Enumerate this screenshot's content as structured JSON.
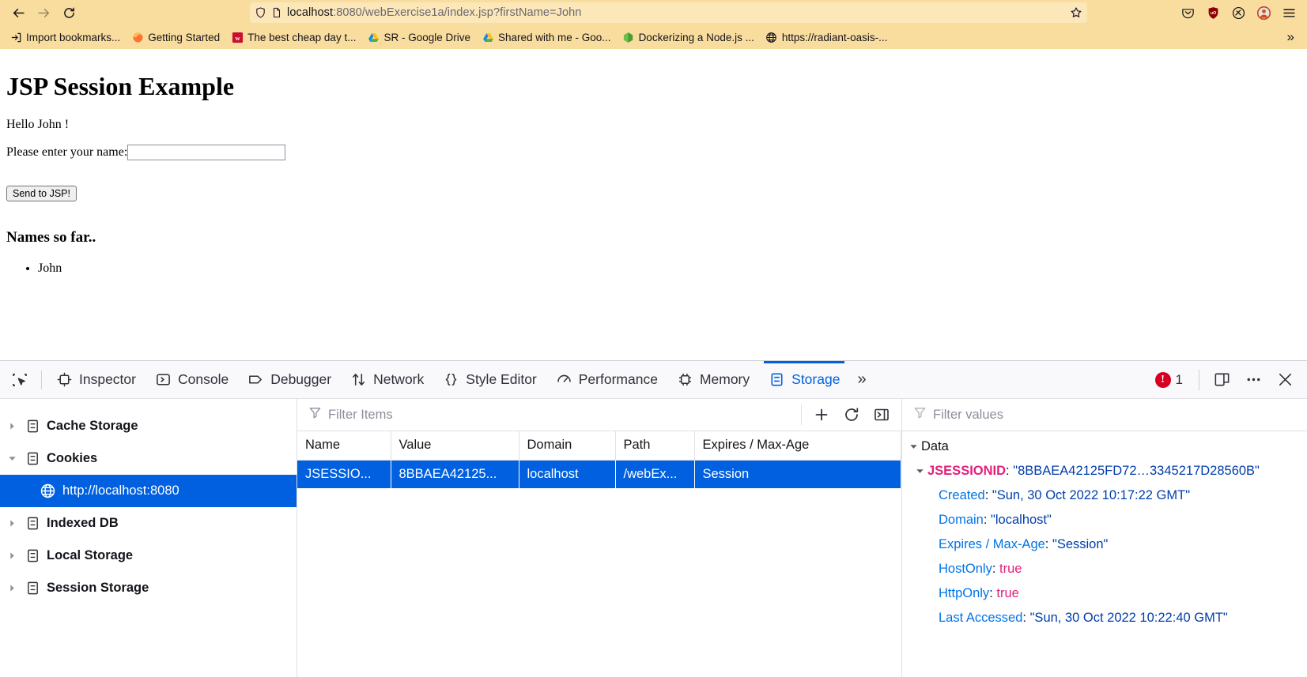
{
  "browser": {
    "nav": {
      "back": "back-arrow",
      "forward": "forward-arrow",
      "reload": "reload"
    },
    "urlbar": {
      "shield_icon": "shield-icon",
      "page_icon": "page-icon",
      "host": "localhost",
      "rest": ":8080/webExercise1a/index.jsp?firstName=John",
      "bookmark_icon": "star-icon"
    },
    "toolbar_icons": [
      {
        "name": "pocket-icon"
      },
      {
        "name": "ublock-origin-icon"
      },
      {
        "name": "extension-icon"
      },
      {
        "name": "account-avatar-icon"
      },
      {
        "name": "app-menu-icon"
      }
    ],
    "bookmarks": [
      {
        "label": "Import bookmarks...",
        "icon": "import-icon"
      },
      {
        "label": "Getting Started",
        "icon": "firefox-icon"
      },
      {
        "label": "The best cheap day t...",
        "icon": "w-icon"
      },
      {
        "label": "SR - Google Drive",
        "icon": "gdrive-icon"
      },
      {
        "label": "Shared with me - Goo...",
        "icon": "gdrive-icon"
      },
      {
        "label": "Dockerizing a Node.js ...",
        "icon": "node-icon"
      },
      {
        "label": "https://radiant-oasis-...",
        "icon": "globe-icon"
      }
    ],
    "bookmarks_overflow": "»"
  },
  "page": {
    "title": "JSP Session Example",
    "greeting": "Hello John !",
    "form_label": "Please enter your name:",
    "input_value": "",
    "input_placeholder": "",
    "submit_label": "Send to JSP!",
    "subtitle": "Names so far..",
    "names": [
      "John"
    ]
  },
  "devtools": {
    "picker_icon": "element-picker-icon",
    "tabs": [
      {
        "label": "Inspector",
        "icon": "inspector-icon",
        "active": false
      },
      {
        "label": "Console",
        "icon": "console-icon",
        "active": false
      },
      {
        "label": "Debugger",
        "icon": "debugger-icon",
        "active": false
      },
      {
        "label": "Network",
        "icon": "network-icon",
        "active": false
      },
      {
        "label": "Style Editor",
        "icon": "style-editor-icon",
        "active": false
      },
      {
        "label": "Performance",
        "icon": "performance-icon",
        "active": false
      },
      {
        "label": "Memory",
        "icon": "memory-icon",
        "active": false
      },
      {
        "label": "Storage",
        "icon": "storage-icon",
        "active": true
      }
    ],
    "overflow_tabs": "»",
    "error_count": "1",
    "error_icon": "error-badge-icon",
    "responsive_icon": "responsive-design-mode-icon",
    "meatball_icon": "devtools-options-icon",
    "close_icon": "close-icon",
    "accent_color": "#0060df",
    "storage_tree": [
      {
        "label": "Cache Storage",
        "expanded": false,
        "selected": false,
        "level": 0,
        "icon": "database-icon"
      },
      {
        "label": "Cookies",
        "expanded": true,
        "selected": false,
        "level": 0,
        "icon": "database-icon"
      },
      {
        "label": "http://localhost:8080",
        "expanded": null,
        "selected": true,
        "level": 1,
        "icon": "globe-icon"
      },
      {
        "label": "Indexed DB",
        "expanded": false,
        "selected": false,
        "level": 0,
        "icon": "database-icon"
      },
      {
        "label": "Local Storage",
        "expanded": false,
        "selected": false,
        "level": 0,
        "icon": "database-icon"
      },
      {
        "label": "Session Storage",
        "expanded": false,
        "selected": false,
        "level": 0,
        "icon": "database-icon"
      }
    ],
    "items_filter_placeholder": "Filter Items",
    "items_filter_value": "",
    "table_actions": [
      {
        "name": "add-item-button",
        "glyph": "+"
      },
      {
        "name": "refresh-items-button",
        "glyph": "refresh"
      },
      {
        "name": "toggle-sidebar-button",
        "glyph": "sidebar"
      }
    ],
    "table": {
      "columns": [
        "Name",
        "Value",
        "Domain",
        "Path",
        "Expires / Max-Age"
      ],
      "rows": [
        {
          "name": "JSESSIO...",
          "value": "8BBAEA42125...",
          "domain": "localhost",
          "path": "/webEx...",
          "expires": "Session",
          "selected": true
        }
      ]
    },
    "values_filter_placeholder": "Filter values",
    "values_filter_value": "",
    "detail": {
      "root_label": "Data",
      "cookie_key": "JSESSIONID",
      "cookie_value": "\"8BBAEA42125FD72…3345217D28560B\"",
      "properties": [
        {
          "key": "Created",
          "value": "\"Sun, 30 Oct 2022 10:17:22 GMT\"",
          "type": "string"
        },
        {
          "key": "Domain",
          "value": "\"localhost\"",
          "type": "string"
        },
        {
          "key": "Expires / Max-Age",
          "value": "\"Session\"",
          "type": "string"
        },
        {
          "key": "HostOnly",
          "value": "true",
          "type": "boolean"
        },
        {
          "key": "HttpOnly",
          "value": "true",
          "type": "boolean"
        },
        {
          "key": "Last Accessed",
          "value": "\"Sun, 30 Oct 2022 10:22:40 GMT\"",
          "type": "string"
        }
      ]
    }
  }
}
